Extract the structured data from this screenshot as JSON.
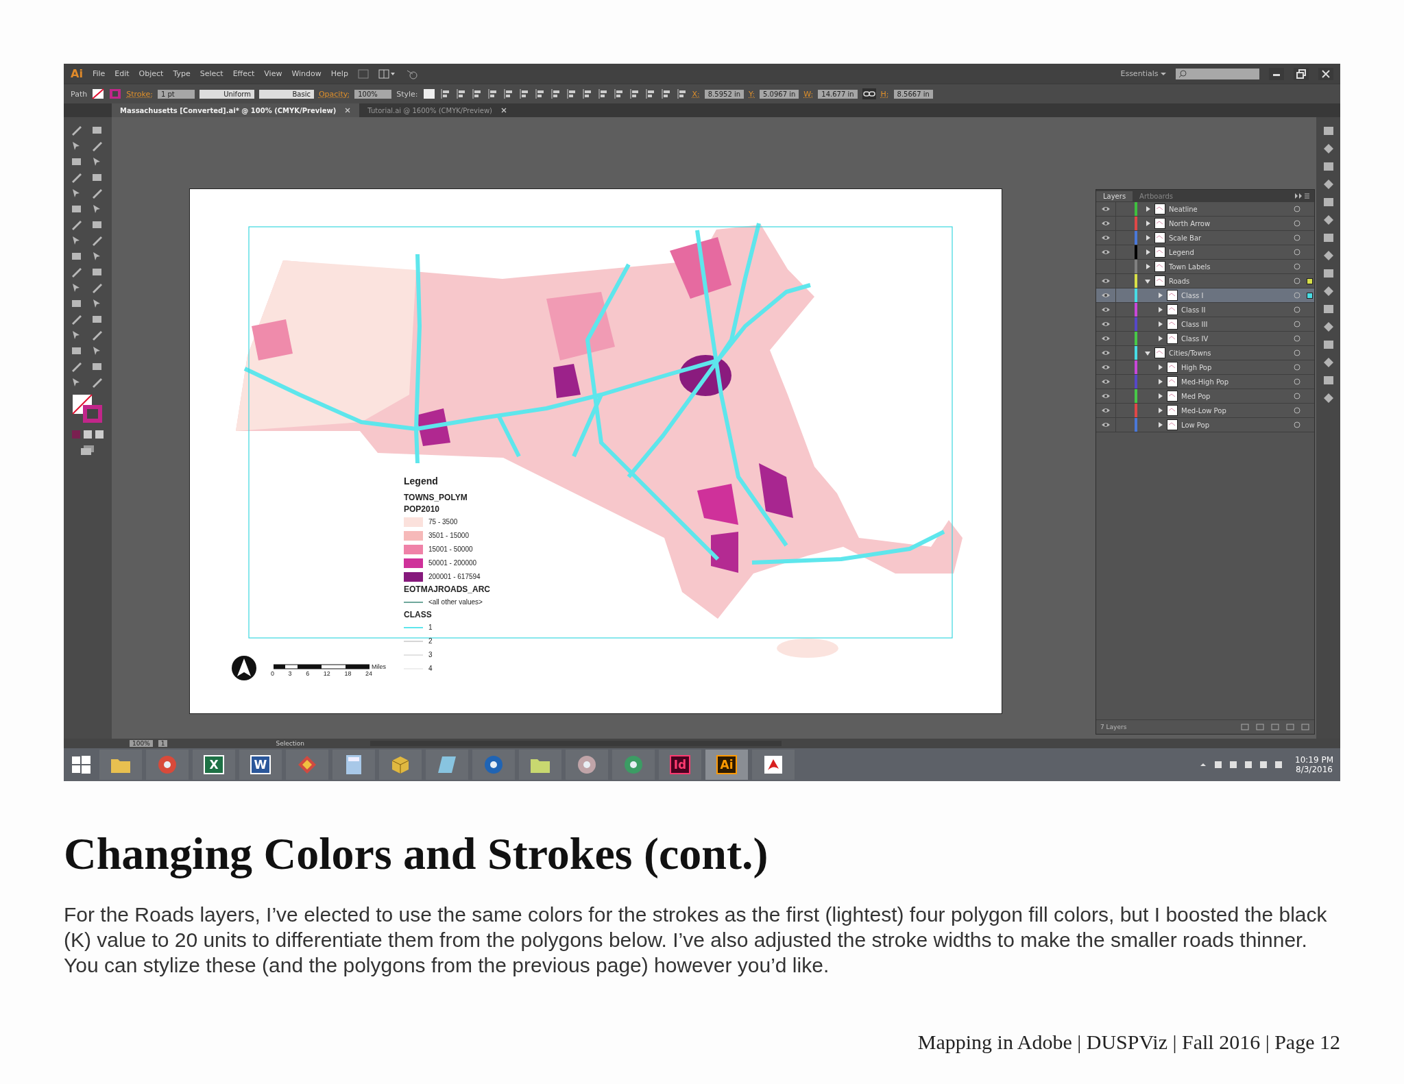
{
  "window": {
    "app_logo": "Ai",
    "menu": [
      "File",
      "Edit",
      "Object",
      "Type",
      "Select",
      "Effect",
      "View",
      "Window",
      "Help"
    ],
    "workspace": "Essentials"
  },
  "control_bar": {
    "selection": "Path",
    "stroke_label": "Stroke:",
    "stroke_weight": "1 pt",
    "profile": "Uniform",
    "brush": "Basic",
    "opacity_label": "Opacity:",
    "opacity": "100%",
    "style_label": "Style:",
    "transform": [
      {
        "label": "X:",
        "value": "8.5952 in"
      },
      {
        "label": "Y:",
        "value": "5.0967 in"
      },
      {
        "label": "W:",
        "value": "14.677 in"
      },
      {
        "label": "H:",
        "value": "8.5667 in"
      }
    ]
  },
  "document_tabs": [
    {
      "title": "Massachusetts [Converted].ai* @ 100% (CMYK/Preview)",
      "selected": true
    },
    {
      "title": "Tutorial.ai @ 1600% (CMYK/Preview)",
      "selected": false
    }
  ],
  "artboard": {
    "legend": {
      "title": "Legend",
      "layer": "TOWNS_POLYM",
      "field": "POP2010",
      "classes": [
        {
          "label": "75 - 3500",
          "color": "#fbe1dc"
        },
        {
          "label": "3501 - 15000",
          "color": "#f6b9b9"
        },
        {
          "label": "15001 - 50000",
          "color": "#ef82a8"
        },
        {
          "label": "50001 - 200000",
          "color": "#cf319a"
        },
        {
          "label": "200001 - 617594",
          "color": "#86197c"
        }
      ],
      "roads_layer": "EOTMAJROADS_ARC",
      "roads_default": {
        "label": "<all other values>",
        "color": "#6fa89c"
      },
      "roads_field": "CLASS",
      "road_classes": [
        {
          "label": "1",
          "color": "#5ee6ec"
        },
        {
          "label": "2",
          "color": "#d6d6d6"
        },
        {
          "label": "3",
          "color": "#e2e2e2"
        },
        {
          "label": "4",
          "color": "#eeeeee"
        }
      ]
    },
    "scale_bar": {
      "ticks": [
        "0",
        "3",
        "6",
        "12",
        "18",
        "24"
      ],
      "unit": "Miles"
    }
  },
  "layers_panel": {
    "tabs": [
      {
        "label": "Layers",
        "selected": true
      },
      {
        "label": "Artboards",
        "selected": false
      }
    ],
    "layers": [
      {
        "name": "Neatline",
        "color": "#3fbf3f",
        "visible": true,
        "expanded": false,
        "selected": false,
        "targeted": false
      },
      {
        "name": "North Arrow",
        "color": "#e04848",
        "visible": true,
        "expanded": false,
        "selected": false,
        "targeted": false
      },
      {
        "name": "Scale Bar",
        "color": "#4a78d8",
        "visible": true,
        "expanded": false,
        "selected": false,
        "targeted": false
      },
      {
        "name": "Legend",
        "color": "#000000",
        "visible": true,
        "expanded": false,
        "selected": false,
        "targeted": false
      },
      {
        "name": "Town Labels",
        "color": "#808080",
        "visible": false,
        "expanded": false,
        "selected": false,
        "targeted": false
      },
      {
        "name": "Roads",
        "color": "#d8e048",
        "visible": true,
        "expanded": true,
        "selected": false,
        "targeted": true,
        "children": [
          {
            "name": "Class I",
            "color": "#48dce4",
            "visible": true,
            "expanded": false,
            "selected": true,
            "targeted": true
          },
          {
            "name": "Class II",
            "color": "#c848d8",
            "visible": true,
            "expanded": false,
            "selected": false,
            "targeted": false
          },
          {
            "name": "Class III",
            "color": "#5648c8",
            "visible": true,
            "expanded": false,
            "selected": false,
            "targeted": false
          },
          {
            "name": "Class IV",
            "color": "#48c848",
            "visible": true,
            "expanded": false,
            "selected": false,
            "targeted": false
          }
        ]
      },
      {
        "name": "Cities/Towns",
        "color": "#48dce4",
        "visible": true,
        "expanded": true,
        "selected": false,
        "targeted": false,
        "children": [
          {
            "name": "High Pop",
            "color": "#c848d8",
            "visible": true,
            "expanded": false,
            "selected": false,
            "targeted": false
          },
          {
            "name": "Med-High Pop",
            "color": "#5648c8",
            "visible": true,
            "expanded": false,
            "selected": false,
            "targeted": false
          },
          {
            "name": "Med Pop",
            "color": "#48c848",
            "visible": true,
            "expanded": false,
            "selected": false,
            "targeted": false
          },
          {
            "name": "Med-Low Pop",
            "color": "#e04848",
            "visible": true,
            "expanded": false,
            "selected": false,
            "targeted": false
          },
          {
            "name": "Low Pop",
            "color": "#4a78d8",
            "visible": true,
            "expanded": false,
            "selected": false,
            "targeted": false
          }
        ]
      }
    ],
    "footer": "7 Layers"
  },
  "status_bar": {
    "zoom": "100%",
    "artboard": "1",
    "tool": "Selection"
  },
  "taskbar": {
    "apps": [
      {
        "kind": "folder",
        "color": "#e8c050",
        "active": false
      },
      {
        "kind": "ball",
        "color": "#d84a3a",
        "active": false
      },
      {
        "kind": "tile",
        "color": "#1e7145",
        "label": {
          "text": "X",
          "color": "#ffffff"
        },
        "active": false
      },
      {
        "kind": "tile",
        "color": "#2b579a",
        "label": {
          "text": "W",
          "color": "#ffffff"
        },
        "active": false
      },
      {
        "kind": "diamond",
        "color": "#d04a40",
        "active": false
      },
      {
        "kind": "grid",
        "color": "#a8c8e8",
        "active": false
      },
      {
        "kind": "cube",
        "color": "#e0b840",
        "active": false
      },
      {
        "kind": "sheet",
        "color": "#88c4e0",
        "active": false
      },
      {
        "kind": "ball",
        "color": "#2064b4",
        "active": false
      },
      {
        "kind": "folder",
        "color": "#c8d870",
        "active": false
      },
      {
        "kind": "ball",
        "color": "#c0a4a8",
        "active": false
      },
      {
        "kind": "ball",
        "color": "#3c9c64",
        "active": false
      },
      {
        "kind": "tile",
        "color": "#49021f",
        "label": {
          "text": "Id",
          "color": "#ff3a70"
        },
        "active": false
      },
      {
        "kind": "tile",
        "color": "#2d1a00",
        "label": {
          "text": "Ai",
          "color": "#ff9a00"
        },
        "active": true
      },
      {
        "kind": "acrobat",
        "color": "#d82020",
        "active": false
      }
    ],
    "time": "10:19 PM",
    "date": "8/3/2016"
  },
  "heading": "Changing Colors and Strokes (cont.)",
  "paragraph": "For the Roads layers, I’ve elected to use the same colors for the strokes as the first (lightest) four polygon fill colors, but I boosted the black (K) value to 20 units to differentiate them from the polygons below. I’ve also adjusted the stroke widths to make the smaller roads thinner. You can stylize these (and the polygons from the previous page) however you’d like.",
  "footer": "Mapping in Adobe | DUSPViz | Fall 2016 | Page 12"
}
